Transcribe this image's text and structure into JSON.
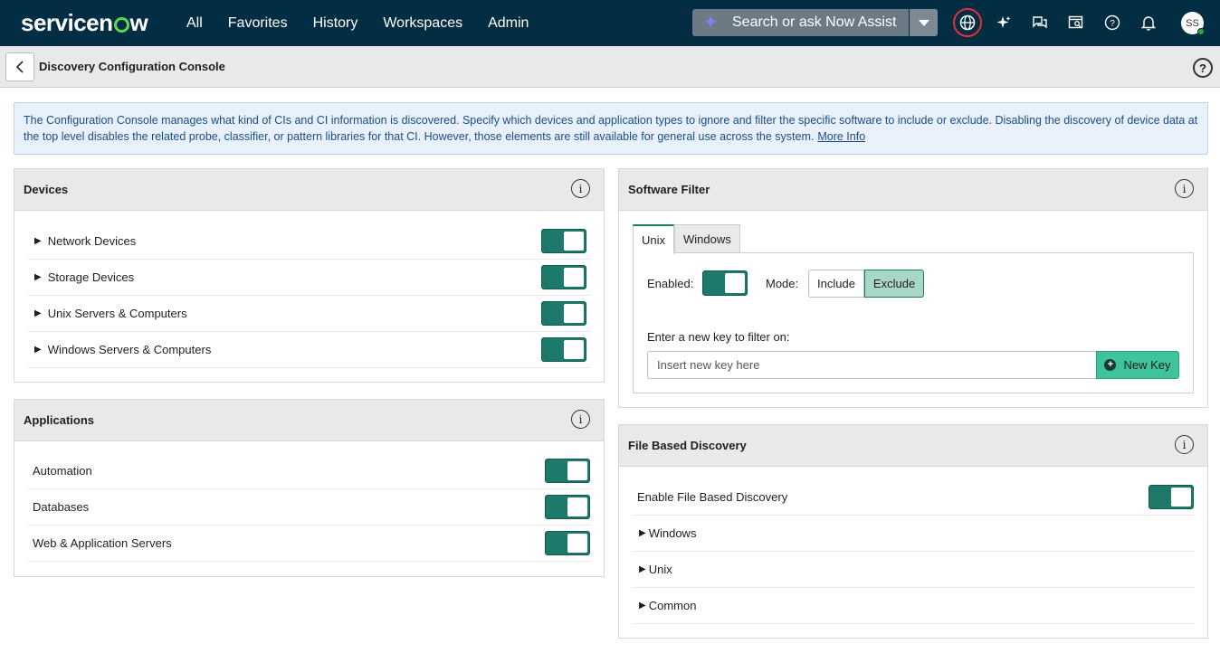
{
  "topnav": {
    "logo_pre": "servicen",
    "logo_post": "w",
    "links": [
      "All",
      "Favorites",
      "History",
      "Workspaces",
      "Admin"
    ],
    "search_placeholder": "Search or ask Now Assist",
    "avatar_initials": "SS"
  },
  "subheader": {
    "title": "Discovery Configuration Console"
  },
  "banner": {
    "text": "The Configuration Console manages what kind of CIs and CI information is discovered. Specify which devices and application types to ignore and filter the specific software to include or exclude. Disabling the discovery of device data at the top level disables the related probe, classifier, or pattern libraries for that CI. However, those elements are still available for general use across the system.",
    "link": "More Info"
  },
  "devices": {
    "title": "Devices",
    "items": [
      {
        "label": "Network Devices",
        "enabled": true
      },
      {
        "label": "Storage Devices",
        "enabled": true
      },
      {
        "label": "Unix Servers & Computers",
        "enabled": true
      },
      {
        "label": "Windows Servers & Computers",
        "enabled": true
      }
    ]
  },
  "applications": {
    "title": "Applications",
    "items": [
      {
        "label": "Automation",
        "enabled": true
      },
      {
        "label": "Databases",
        "enabled": true
      },
      {
        "label": "Web & Application Servers",
        "enabled": true
      }
    ]
  },
  "software_filter": {
    "title": "Software Filter",
    "tabs": [
      "Unix",
      "Windows"
    ],
    "active_tab": "Unix",
    "enabled_label": "Enabled:",
    "mode_label": "Mode:",
    "mode_options": [
      "Include",
      "Exclude"
    ],
    "mode_selected": "Exclude",
    "key_label": "Enter a new key to filter on:",
    "key_placeholder": "Insert new key here",
    "new_key_label": "New Key"
  },
  "file_based": {
    "title": "File Based Discovery",
    "enable_label": "Enable File Based Discovery",
    "items": [
      "Windows",
      "Unix",
      "Common"
    ]
  },
  "colors": {
    "nav_bg": "#032d42",
    "toggle_on": "#1d7a6b",
    "new_key_bg": "#3fc39a",
    "banner_bg": "#e8f1fb"
  }
}
